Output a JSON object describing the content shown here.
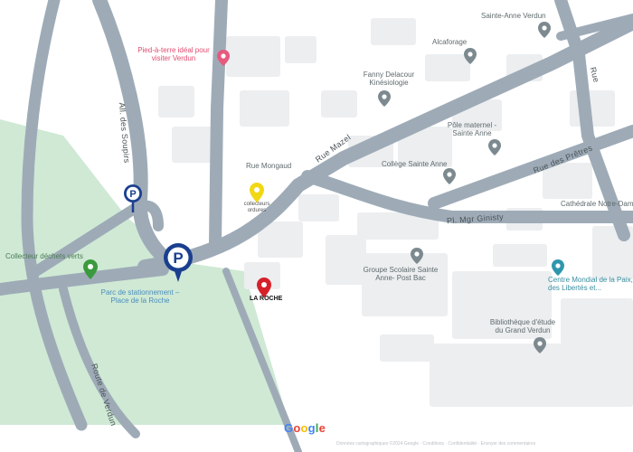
{
  "map": {
    "attribution": "Données cartographiques ©2024 Google · Conditions · Confidentialité · Envoyer des commentaires",
    "google_logo": {
      "letters": [
        "G",
        "o",
        "o",
        "g",
        "l",
        "e"
      ],
      "colors": [
        "#4285f4",
        "#ea4335",
        "#fbbc05",
        "#4285f4",
        "#34a853",
        "#ea4335"
      ]
    },
    "street_labels": {
      "allee_des_soupirs": "All. des Soupirs",
      "rue_mazel": "Rue Mazel",
      "rue_des_pretres": "Rue des Prêtres",
      "pl_mgr_ginisty": "Pl. Mgr Ginisty",
      "rue_mongaud": "Rue Mongaud",
      "route_bottom": "Route de Verdun",
      "rue_right": "Rue"
    },
    "pois": {
      "pied_a_terre": "Pied-à-terre idéal pour visiter Verdun",
      "sainte_anne_verdun": "Sainte-Anne Verdun",
      "alcaforage": "Alcaforage",
      "fanny": "Fanny Delacour Kinésiologie",
      "pole_maternel": "Pôle maternel - Sainte Anne",
      "college": "Collège Sainte Anne",
      "cathedrale": "Cathédrale Notre-Dame",
      "groupe_scolaire": "Groupe Scolaire Sainte Anne- Post Bac",
      "centre_mondial": "Centre Mondial de la Paix, des Libertés et...",
      "bibliotheque": "Bibliothèque d'étude du Grand Verdun"
    },
    "markers": {
      "parking_small_icon": "P",
      "parking_large_icon": "P",
      "parking_label": "Parc de stationnement – Place de la Roche",
      "yellow_collector": "collecteurs ordures",
      "green_collector": "Collecteur déchets verts",
      "la_roche": "LA ROCHE"
    },
    "colors": {
      "background": "#ffffff",
      "road": "#9eabb7",
      "building": "#eceef0",
      "park": "#cfe9d5",
      "parking_marker": "#1a3f8f",
      "red_pin": "#d6202a",
      "yellow_pin": "#f2d715",
      "green_pin": "#3b9a3f",
      "grey_poi": "#7c8a90",
      "pink_poi": "#e65a7e",
      "teal_poi": "#2f97ad"
    }
  }
}
